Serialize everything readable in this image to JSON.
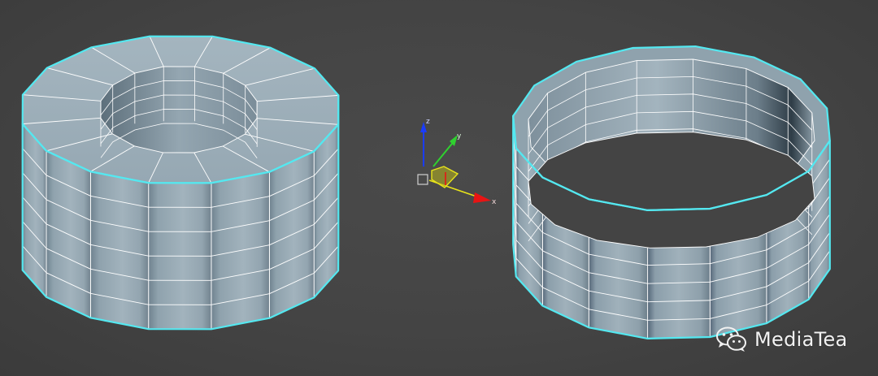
{
  "viewport": {
    "background": "#444444",
    "mesh_fill": "#98aab5",
    "mesh_shadow": "#5d6f7b",
    "wire_color": "#ffffff",
    "selection_outline": "#54e8f0"
  },
  "objects": [
    {
      "name": "tube",
      "state": "selected"
    },
    {
      "name": "tube-shell",
      "state": "selected"
    }
  ],
  "gizmo": {
    "x_label": "x",
    "y_label": "y",
    "z_label": "z",
    "x_color": "#e81414",
    "y_color": "#2fd12f",
    "z_color": "#1a3cff",
    "plane_color": "#e8e41a"
  },
  "watermark": {
    "icon": "wechat-icon",
    "text": "MediaTea"
  }
}
